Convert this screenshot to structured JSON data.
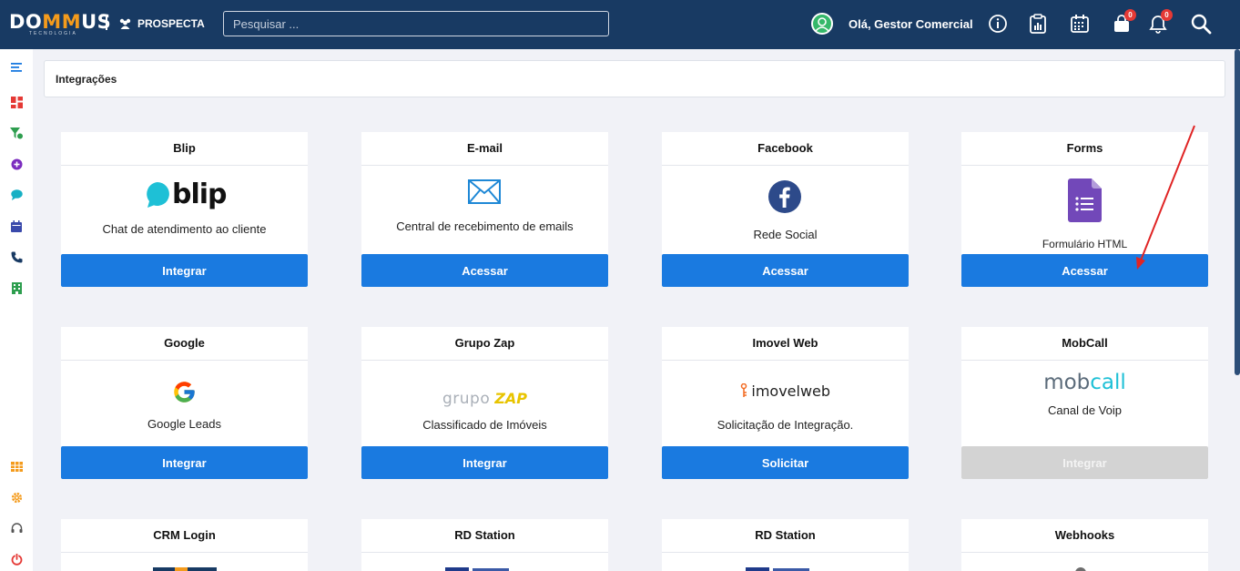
{
  "header": {
    "logo_pre": "DO",
    "logo_mm": "MM",
    "logo_post": "US",
    "logo_sub": "TECNOLOGIA",
    "module_label": "PROSPECTA",
    "search_placeholder": "Pesquisar ...",
    "greeting": "Olá, Gestor Comercial",
    "cart_count": "0",
    "bell_count": "0",
    "colors": {
      "bar": "#183a63",
      "accent": "#f49b1c",
      "badge": "#e53935"
    }
  },
  "page": {
    "title": "Integrações"
  },
  "cards": [
    {
      "title": "Blip",
      "desc": "Chat de atendimento ao cliente",
      "logo_text": "blip",
      "button": "Integrar",
      "icon": "blip-logo"
    },
    {
      "title": "E-mail",
      "desc": "Central de recebimento de emails",
      "button": "Acessar",
      "icon": "envelope-icon"
    },
    {
      "title": "Facebook",
      "desc": "Rede Social",
      "button": "Acessar",
      "icon": "facebook-icon"
    },
    {
      "title": "Forms",
      "desc": "Formulário HTML",
      "button": "Acessar",
      "icon": "google-forms-icon"
    },
    {
      "title": "Google",
      "desc": "Google Leads",
      "button": "Integrar",
      "icon": "google-icon"
    },
    {
      "title": "Grupo Zap",
      "desc": "Classificado de Imóveis",
      "logo_a": "grupo",
      "logo_b": "ZAP",
      "button": "Integrar",
      "icon": "grupo-zap-logo"
    },
    {
      "title": "Imovel Web",
      "desc": "Solicitação de Integração.",
      "logo_text": "imovelweb",
      "button": "Solicitar",
      "icon": "imovelweb-logo"
    },
    {
      "title": "MobCall",
      "desc": "Canal de Voip",
      "logo_a": "mob",
      "logo_b": "call",
      "button": "Integrar",
      "button_disabled": true,
      "icon": "mobcall-logo"
    },
    {
      "title": "CRM Login",
      "icon": "dommus-logo"
    },
    {
      "title": "RD Station",
      "icon": "rd-station-logo"
    },
    {
      "title": "RD Station",
      "icon": "rd-station-logo"
    },
    {
      "title": "Webhooks",
      "icon": "webhook-icon"
    }
  ],
  "button_color": "#1a7ae0",
  "annotation": {
    "color": "#e02424",
    "icon": "red-arrow"
  }
}
